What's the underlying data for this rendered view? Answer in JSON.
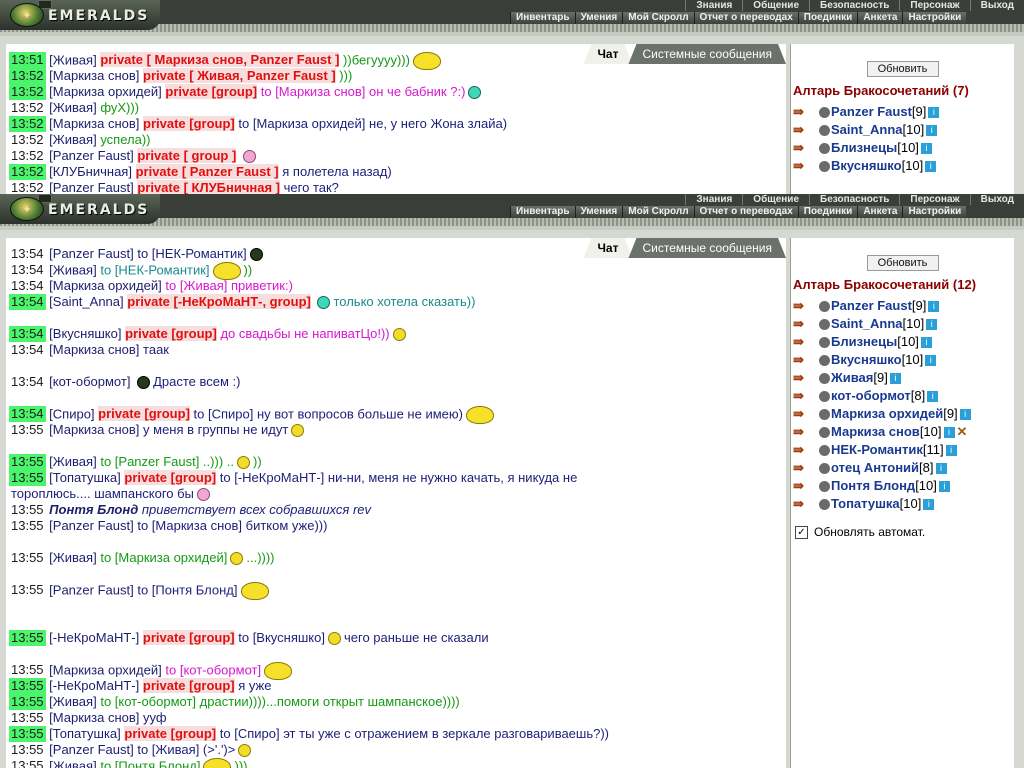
{
  "app": {
    "brand": "EMERALDS",
    "colors": {
      "highlight_time": "#4af56b",
      "private": "#e01010",
      "nick": "#1e1e6e",
      "room_title": "#8a0000"
    }
  },
  "nav_main": [
    "Знания",
    "Общение",
    "Безопасность",
    "Персонаж",
    "Выход"
  ],
  "nav_sub": [
    "Инвентарь",
    "Умения",
    "Мой Скролл",
    "Отчет о переводах",
    "Поединки",
    "Анкета",
    "Настройки"
  ],
  "tabs": {
    "chat": "Чат",
    "system": "Системные сообщения"
  },
  "sidebar": {
    "refresh": "Обновить",
    "auto_update": "Обновлять автомат."
  },
  "window1": {
    "room": "Алтарь Бракосочетаний (7)",
    "users": [
      {
        "name": "Panzer Faust",
        "level": "[9]"
      },
      {
        "name": "Saint_Anna",
        "level": "[10]"
      },
      {
        "name": "Близнецы",
        "level": "[10]"
      },
      {
        "name": "Вкусняшко",
        "level": "[10]"
      }
    ],
    "lines": [
      {
        "t": "13:51",
        "hl": true,
        "nick": "[Живая]",
        "priv": "private [ Маркиза снов, Panzer Faust ]",
        "after": "))",
        "mtext": "бегуууу)))",
        "mcls": "grn",
        "smile": "big"
      },
      {
        "t": "13:52",
        "hl": true,
        "nick": "[Маркиза снов]",
        "priv": "private [ Живая, Panzer Faust ]",
        "after": ")))"
      },
      {
        "t": "13:52",
        "hl": true,
        "nick": "[Маркиза орхидей]",
        "priv": "private [group]",
        "mtext": "to [Маркиза снов] он че бабник ?:)",
        "mcls": "mg",
        "smile": "teal"
      },
      {
        "t": "13:52",
        "hl": false,
        "nick": "[Живая]",
        "mtext": "фуХ)))",
        "mcls": "grn"
      },
      {
        "t": "13:52",
        "hl": true,
        "nick": "[Маркиза снов]",
        "priv": "private [group]",
        "mtext": "to [Маркиза орхидей] не, у него Жона злайа)",
        "mcls": "nv"
      },
      {
        "t": "13:52",
        "hl": false,
        "nick": "[Живая]",
        "mtext": "успела))",
        "mcls": "grn"
      },
      {
        "t": "13:52",
        "hl": false,
        "nick": "[Panzer Faust]",
        "priv": "private [ group ]",
        "smile": "pink"
      },
      {
        "t": "13:52",
        "hl": true,
        "nick": "[КЛУБничная]",
        "priv": "private [ Panzer Faust ]",
        "mtext": "я полетела назад)",
        "mcls": "nv"
      },
      {
        "t": "13:52",
        "hl": false,
        "nick": "[Panzer Faust]",
        "priv": "private [ КЛУБничная ]",
        "mtext": "чего так?",
        "mcls": "nv"
      }
    ]
  },
  "window2": {
    "room": "Алтарь Бракосочетаний (12)",
    "users": [
      {
        "name": "Panzer Faust",
        "level": "[9]"
      },
      {
        "name": "Saint_Anna",
        "level": "[10]"
      },
      {
        "name": "Близнецы",
        "level": "[10]"
      },
      {
        "name": "Вкусняшко",
        "level": "[10]"
      },
      {
        "name": "Живая",
        "level": "[9]"
      },
      {
        "name": "кот-обормот",
        "level": "[8]"
      },
      {
        "name": "Маркиза орхидей",
        "level": "[9]"
      },
      {
        "name": "Маркиза снов",
        "level": "[10]",
        "x": "✕"
      },
      {
        "name": "НЕК-Романтик",
        "level": "[11]"
      },
      {
        "name": "отец Антоний",
        "level": "[8]"
      },
      {
        "name": "Понтя Блонд",
        "level": "[10]"
      },
      {
        "name": "Топатушка",
        "level": "[10]"
      }
    ],
    "lines": [
      {
        "t": "13:54",
        "hl": false,
        "nick": "[Panzer Faust]",
        "mtext": "to [НЕК-Романтик]",
        "mcls": "nv",
        "smile": "dark"
      },
      {
        "t": "13:54",
        "hl": false,
        "nick": "[Живая]",
        "mtext": "to [НЕК-Романтик]",
        "mcls": "tg",
        "smile": "big",
        "tail": "))",
        "tcls": "grn"
      },
      {
        "t": "13:54",
        "hl": false,
        "nick": "[Маркиза орхидей]",
        "mtext": "to [Живая] приветик:)",
        "mcls": "mg"
      },
      {
        "t": "13:54",
        "hl": true,
        "nick": "[Saint_Anna]",
        "priv": "private [-НеКроМаНТ-, group]",
        "smile": "teal",
        "tail": "только хотела сказать))",
        "tcls": "tg"
      },
      {
        "t": "",
        "hl": false
      },
      {
        "t": "13:54",
        "hl": true,
        "nick": "[Вкусняшко]",
        "priv": "private [group]",
        "mtext": "до свадьбы не напиватЦо!))",
        "mcls": "mg",
        "smile": "default"
      },
      {
        "t": "13:54",
        "hl": false,
        "nick": "[Маркиза снов]",
        "mtext": "таак",
        "mcls": "nv"
      },
      {
        "t": "",
        "hl": false
      },
      {
        "t": "13:54",
        "hl": false,
        "nick": "[кот-обормот]",
        "smile": "dark",
        "tail": "Дрaсте всем :)",
        "tcls": "nv"
      },
      {
        "t": "",
        "hl": false
      },
      {
        "t": "13:54",
        "hl": true,
        "nick": "[Спиро]",
        "priv": "private [group]",
        "mtext": "to [Спиро] ну вот вопросов больше не имею)",
        "mcls": "nv",
        "smile": "big"
      },
      {
        "t": "13:55",
        "hl": false,
        "nick": "[Маркиза снов]",
        "mtext": "у меня в группы не идут",
        "mcls": "nv",
        "smile": "default"
      },
      {
        "t": "",
        "hl": false
      },
      {
        "t": "13:55",
        "hl": true,
        "nick": "[Живая]",
        "mtext": "to [Panzer Faust] ..))) ..",
        "mcls": "grn",
        "smile": "default",
        "tail": "))",
        "tcls": "grn"
      },
      {
        "t": "13:55",
        "hl": true,
        "nick": "[Топатушка]",
        "priv": "private [group]",
        "mtext": "to [-НеКроМаНТ-] ни-ни, меня не нужно качать, я никуда не",
        "mcls": "nv"
      },
      {
        "t": "",
        "hl": false,
        "mtext": "тороплюсь.... шампанского бы",
        "mcls": "nv",
        "smile": "pink",
        "indent": true
      },
      {
        "t": "13:55",
        "hl": false,
        "italic": "Понтя Блонд",
        "tail": "приветствует всех собравшихся rev",
        "tcls": "it"
      },
      {
        "t": "13:55",
        "hl": false,
        "nick": "[Panzer Faust]",
        "mtext": "to [Маркиза снов] битком уже)))",
        "mcls": "nv"
      },
      {
        "t": "",
        "hl": false
      },
      {
        "t": "13:55",
        "hl": false,
        "nick": "[Живая]",
        "mtext": "to [Маркиза орхидей]",
        "mcls": "grn",
        "smile": "default",
        "tail": "...))))",
        "tcls": "grn"
      },
      {
        "t": "",
        "hl": false
      },
      {
        "t": "13:55",
        "hl": false,
        "nick": "[Panzer Faust]",
        "mtext": "to [Понтя Блонд]",
        "mcls": "nv",
        "smile": "big"
      },
      {
        "t": "",
        "hl": false
      },
      {
        "t": "",
        "hl": false
      },
      {
        "t": "13:55",
        "hl": true,
        "nick": "[-НеКроМаНТ-]",
        "priv": "private [group]",
        "mtext": "to [Вкусняшко]",
        "mcls": "nv",
        "smile": "default",
        "tail": "чего раньше не сказали",
        "tcls": "nv"
      },
      {
        "t": "",
        "hl": false
      },
      {
        "t": "13:55",
        "hl": false,
        "nick": "[Маркиза орхидей]",
        "mtext": "to [кот-обормот]",
        "mcls": "mg",
        "smile": "big"
      },
      {
        "t": "13:55",
        "hl": true,
        "nick": "[-НеКроМаНТ-]",
        "priv": "private [group]",
        "mtext": "я уже",
        "mcls": "nv"
      },
      {
        "t": "13:55",
        "hl": true,
        "nick": "[Живая]",
        "mtext": "to [кот-обормот] драстии))))...помоги открыт шампанское))))",
        "mcls": "grn"
      },
      {
        "t": "13:55",
        "hl": false,
        "nick": "[Маркиза снов]",
        "mtext": "ууф",
        "mcls": "nv"
      },
      {
        "t": "13:55",
        "hl": true,
        "nick": "[Топатушка]",
        "priv": "private [group]",
        "mtext": "to [Спиро] эт ты уже с отражением в зеркале разговариваешь?))",
        "mcls": "nv"
      },
      {
        "t": "13:55",
        "hl": false,
        "nick": "[Panzer Faust]",
        "mtext": "to [Живая] (>'.')>",
        "mcls": "nv",
        "smile": "default"
      },
      {
        "t": "13:55",
        "hl": false,
        "nick": "[Живая]",
        "mtext": "to [Понтя Блонд]",
        "mcls": "grn",
        "smile": "big",
        "tail": ")))",
        "tcls": "grn"
      }
    ]
  }
}
